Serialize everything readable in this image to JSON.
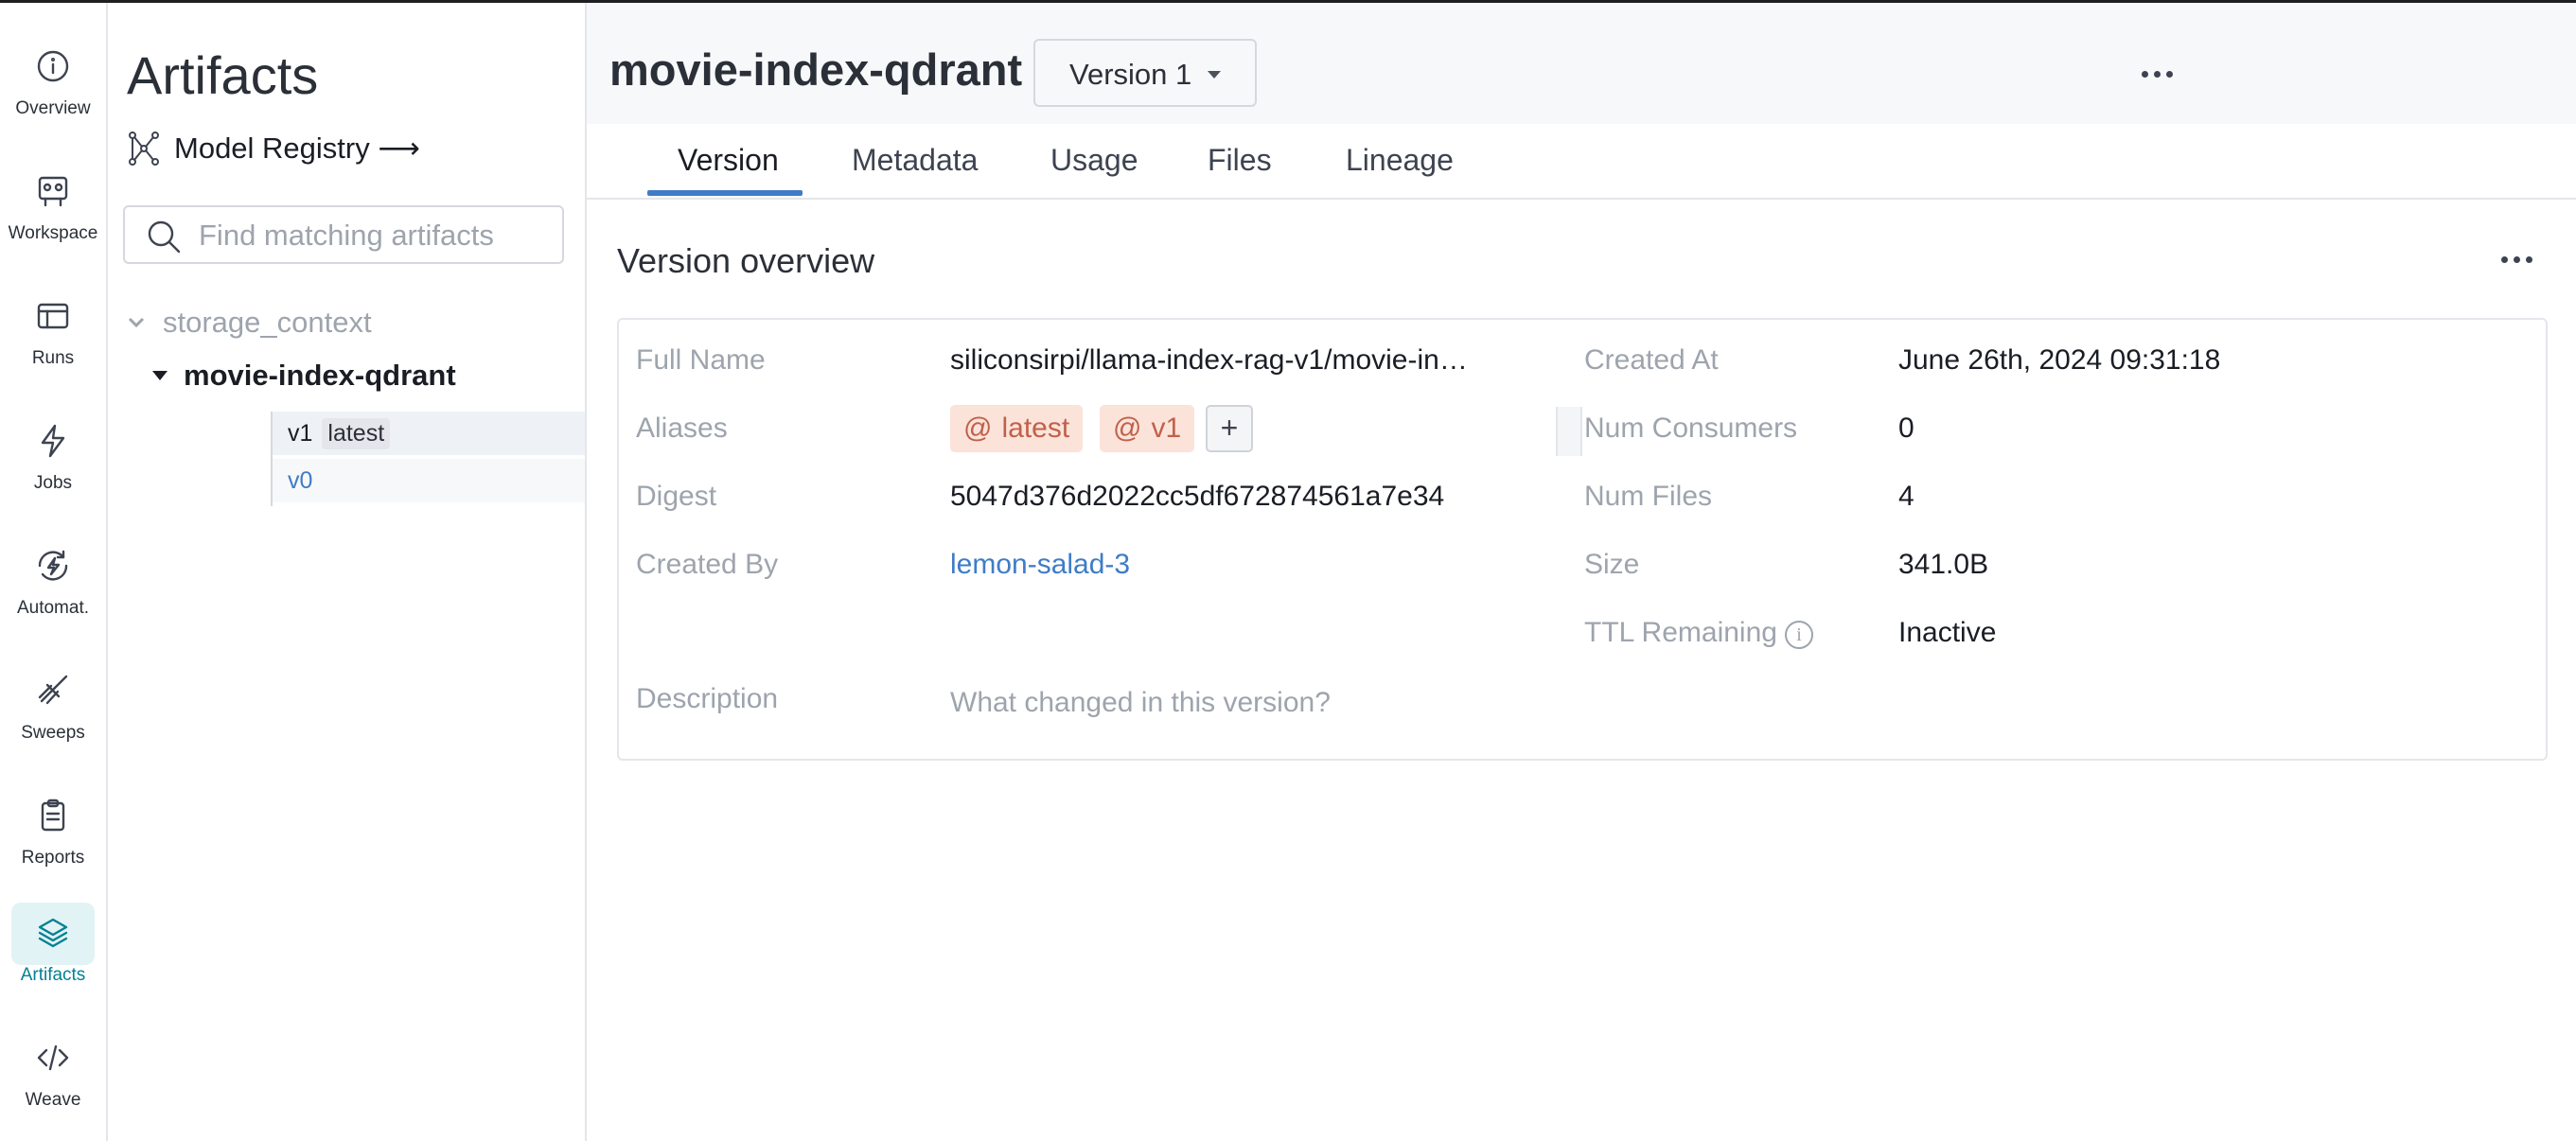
{
  "nav": [
    {
      "label": "Overview",
      "icon": "info-circle-icon"
    },
    {
      "label": "Workspace",
      "icon": "workspace-icon"
    },
    {
      "label": "Runs",
      "icon": "table-icon"
    },
    {
      "label": "Jobs",
      "icon": "lightning-icon"
    },
    {
      "label": "Automat.",
      "icon": "automation-icon"
    },
    {
      "label": "Sweeps",
      "icon": "broom-icon"
    },
    {
      "label": "Reports",
      "icon": "clipboard-icon"
    },
    {
      "label": "Artifacts",
      "icon": "layers-icon",
      "active": true
    },
    {
      "label": "Weave",
      "icon": "code-icon"
    }
  ],
  "panel": {
    "title": "Artifacts",
    "registry_link": "Model Registry ⟶",
    "search_placeholder": "Find matching artifacts",
    "tree": {
      "parent": "storage_context",
      "child": "movie-index-qdrant",
      "versions": [
        {
          "name": "v1",
          "tag": "latest",
          "selected": true
        },
        {
          "name": "v0",
          "tag": ""
        }
      ]
    }
  },
  "header": {
    "artifact_name": "movie-index-qdrant",
    "version_dropdown": "Version 1"
  },
  "tabs": [
    "Version",
    "Metadata",
    "Usage",
    "Files",
    "Lineage"
  ],
  "active_tab": "Version",
  "overview": {
    "title": "Version overview",
    "left": {
      "full_name_label": "Full Name",
      "full_name": "siliconsirpi/llama-index-rag-v1/movie-in…",
      "aliases_label": "Aliases",
      "aliases": [
        "latest",
        "v1"
      ],
      "alias_prefix": "@",
      "add_alias": "+",
      "digest_label": "Digest",
      "digest": "5047d376d2022cc5df672874561a7e34",
      "created_by_label": "Created By",
      "created_by": "lemon-salad-3",
      "description_label": "Description",
      "description_placeholder": "What changed in this version?"
    },
    "right": {
      "created_at_label": "Created At",
      "created_at": "June 26th, 2024 09:31:18",
      "num_consumers_label": "Num Consumers",
      "num_consumers": "0",
      "num_files_label": "Num Files",
      "num_files": "4",
      "size_label": "Size",
      "size": "341.0B",
      "ttl_label": "TTL Remaining",
      "ttl": "Inactive",
      "info_glyph": "i"
    }
  },
  "colors": {
    "accent": "#3f7cc7",
    "nav_active": "#038194",
    "alias_bg": "#fbe3da",
    "alias_text": "#c0614a"
  }
}
